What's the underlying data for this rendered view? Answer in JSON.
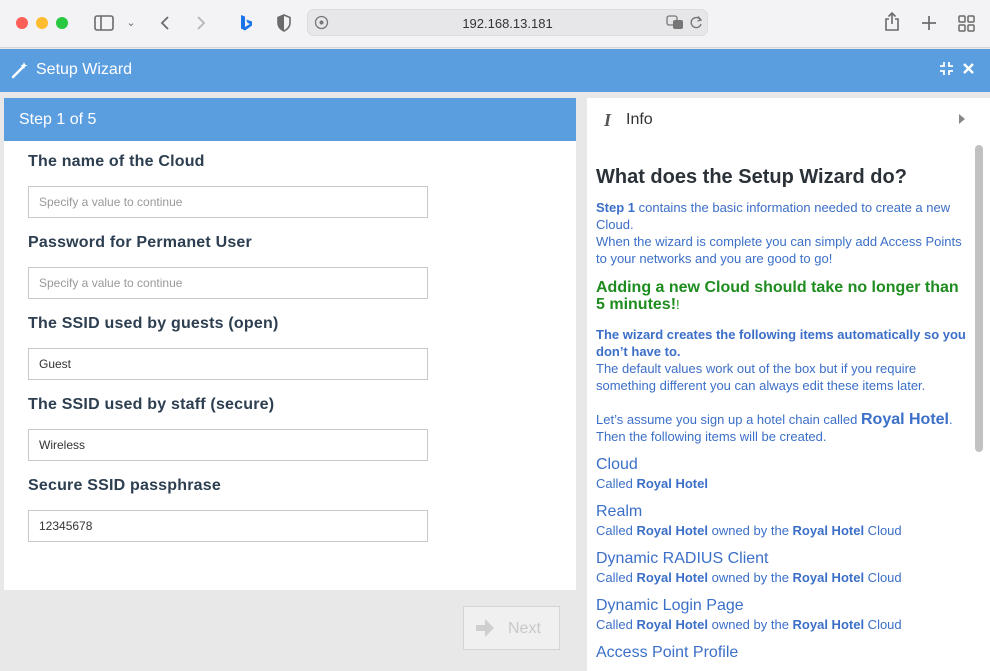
{
  "browser": {
    "url": "192.168.13.181"
  },
  "app": {
    "title": "Setup Wizard"
  },
  "wizard": {
    "step_label": "Step 1 of 5",
    "fields": [
      {
        "label": "The name of the Cloud",
        "value": "",
        "placeholder": "Specify a value to continue"
      },
      {
        "label": "Password for Permanet User",
        "value": "",
        "placeholder": "Specify a value to continue"
      },
      {
        "label": "The SSID used by guests (open)",
        "value": "Guest",
        "placeholder": ""
      },
      {
        "label": "The SSID used by staff (secure)",
        "value": "Wireless",
        "placeholder": ""
      },
      {
        "label": "Secure SSID passphrase",
        "value": "12345678",
        "placeholder": ""
      }
    ],
    "next_label": "Next"
  },
  "info": {
    "header": "Info",
    "title": "What does the Setup Wizard do?",
    "p1_bold": "Step 1",
    "p1_text": " contains the basic information needed to create a new Cloud.",
    "p1_line2": "When the wizard is complete you can simply add Access Points to your networks and you are good to go!",
    "green": "Adding a new Cloud should take no longer than 5 minutes!",
    "green_tail": "!",
    "p3_bold": "The wizard creates the following items automatically so you don’t have to.",
    "p3_text": "The default values work out of the box but if you require something different you can always edit these items later.",
    "p4_pre": "Let’s assume you sign up a hotel chain called ",
    "p4_name": "Royal Hotel",
    "p4_post": ".",
    "p4_line2": "Then the following items will be created.",
    "items": [
      {
        "title": "Cloud",
        "called": "Called ",
        "name": "Royal Hotel",
        "owned": "",
        "owner": "",
        "suffix": ""
      },
      {
        "title": "Realm",
        "called": "Called ",
        "name": "Royal Hotel",
        "owned": " owned by the ",
        "owner": "Royal Hotel",
        "suffix": " Cloud"
      },
      {
        "title": "Dynamic RADIUS Client",
        "called": "Called ",
        "name": "Royal Hotel",
        "owned": " owned by the ",
        "owner": "Royal Hotel",
        "suffix": " Cloud"
      },
      {
        "title": "Dynamic Login Page",
        "called": "Called ",
        "name": "Royal Hotel",
        "owned": " owned by the ",
        "owner": "Royal Hotel",
        "suffix": " Cloud"
      },
      {
        "title": "Access Point Profile"
      }
    ]
  },
  "colors": {
    "accent": "#5b9ee0",
    "info_text": "#3c6fc8",
    "green": "#1e8c1e"
  }
}
